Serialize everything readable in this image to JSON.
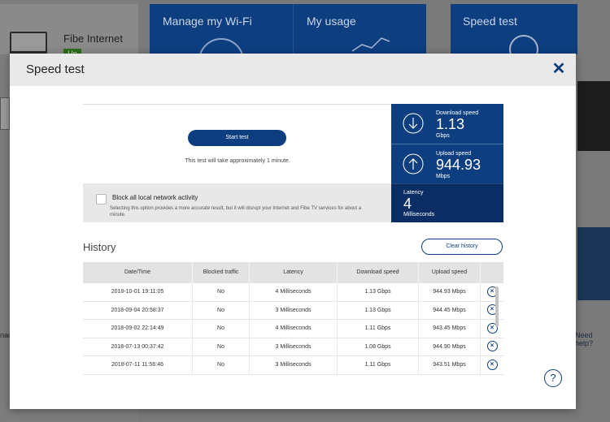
{
  "background": {
    "connection": {
      "name": "Fibe Internet",
      "status": "Up"
    },
    "tiles": [
      {
        "label": "Manage my Wi-Fi"
      },
      {
        "label": "My usage"
      },
      {
        "label": "Speed test"
      }
    ],
    "need_help": "Need help?",
    "cut_text": "nad"
  },
  "modal": {
    "title": "Speed test",
    "close_icon": "close-icon",
    "start_button": "Start test",
    "test_note": "This test will take approximately 1 minute.",
    "block_option": {
      "title": "Block all local network activity",
      "description": "Selecting this option provides a more accurate result, but it will disrupt your Internet and Fibe TV services for about a minute."
    },
    "results": {
      "download": {
        "label": "Download speed",
        "value": "1.13",
        "unit": "Gbps"
      },
      "upload": {
        "label": "Upload speed",
        "value": "944.93",
        "unit": "Mbps"
      },
      "latency": {
        "label": "Latency",
        "value": "4",
        "unit": "Milliseconds"
      }
    },
    "history": {
      "title": "History",
      "clear_button": "Clear history",
      "columns": [
        "Date/Time",
        "Blocked traffic",
        "Latency",
        "Download speed",
        "Upload speed"
      ],
      "rows": [
        {
          "date": "2018-10-01 19:11:05",
          "blocked": "No",
          "latency": "4 Milliseconds",
          "download": "1.13 Gbps",
          "upload": "944.93 Mbps"
        },
        {
          "date": "2018-09-04 20:58:37",
          "blocked": "No",
          "latency": "3 Milliseconds",
          "download": "1.13 Gbps",
          "upload": "944.45 Mbps"
        },
        {
          "date": "2018-09-02 22:14:49",
          "blocked": "No",
          "latency": "4 Milliseconds",
          "download": "1.11 Gbps",
          "upload": "943.45 Mbps"
        },
        {
          "date": "2018-07-13 00:37:42",
          "blocked": "No",
          "latency": "3 Milliseconds",
          "download": "1.08 Gbps",
          "upload": "944.90 Mbps"
        },
        {
          "date": "2018-07-11 11:56:46",
          "blocked": "No",
          "latency": "3 Milliseconds",
          "download": "1.11 Gbps",
          "upload": "943.51 Mbps"
        }
      ]
    },
    "help_icon": "?"
  },
  "colors": {
    "brand": "#0d3e80",
    "latency_bg": "#0a2e63",
    "status_up": "#2f6e1c"
  }
}
